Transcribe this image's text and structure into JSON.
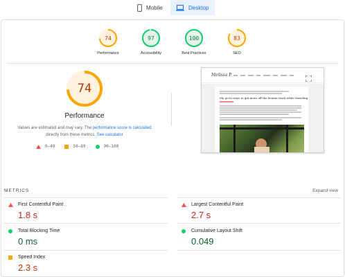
{
  "device_tabs": [
    {
      "label": "Mobile",
      "icon": "phone-icon",
      "active": false
    },
    {
      "label": "Desktop",
      "icon": "laptop-icon",
      "active": true
    }
  ],
  "summary_scores": [
    {
      "label": "Performance",
      "score": "74",
      "status": "average"
    },
    {
      "label": "Accessibility",
      "score": "97",
      "status": "pass"
    },
    {
      "label": "Best Practices",
      "score": "100",
      "status": "pass"
    },
    {
      "label": "SEO",
      "score": "83",
      "status": "average"
    }
  ],
  "performance": {
    "score": "74",
    "title": "Performance",
    "note_prefix": "Values are estimated and may vary. The ",
    "note_link1": "performance score is calculated",
    "note_middle": " directly from these metrics. ",
    "note_link2": "See calculator",
    "note_suffix": "."
  },
  "legend": [
    {
      "range": "0–49",
      "shape": "triangle",
      "color": "#ff4e42"
    },
    {
      "range": "50–89",
      "shape": "square",
      "color": "#ffa400"
    },
    {
      "range": "90–100",
      "shape": "circle",
      "color": "#0cce6b"
    }
  ],
  "screenshot": {
    "logo": "Melissa P.",
    "headline": "My go-to ways to get more off the beaten track while traveling"
  },
  "metrics_section": {
    "title": "METRICS",
    "expand_label": "Expand view"
  },
  "metrics": [
    {
      "name": "First Contentful Paint",
      "value": "1.8 s",
      "status": "fail"
    },
    {
      "name": "Largest Contentful Paint",
      "value": "2.7 s",
      "status": "fail"
    },
    {
      "name": "Total Blocking Time",
      "value": "0 ms",
      "status": "pass"
    },
    {
      "name": "Cumulative Layout Shift",
      "value": "0.049",
      "status": "pass"
    },
    {
      "name": "Speed Index",
      "value": "2.3 s",
      "status": "average"
    }
  ],
  "colors": {
    "fail": "#ff4e42",
    "average": "#ffa400",
    "pass": "#0cce6b",
    "accent": "#1a73e8"
  }
}
